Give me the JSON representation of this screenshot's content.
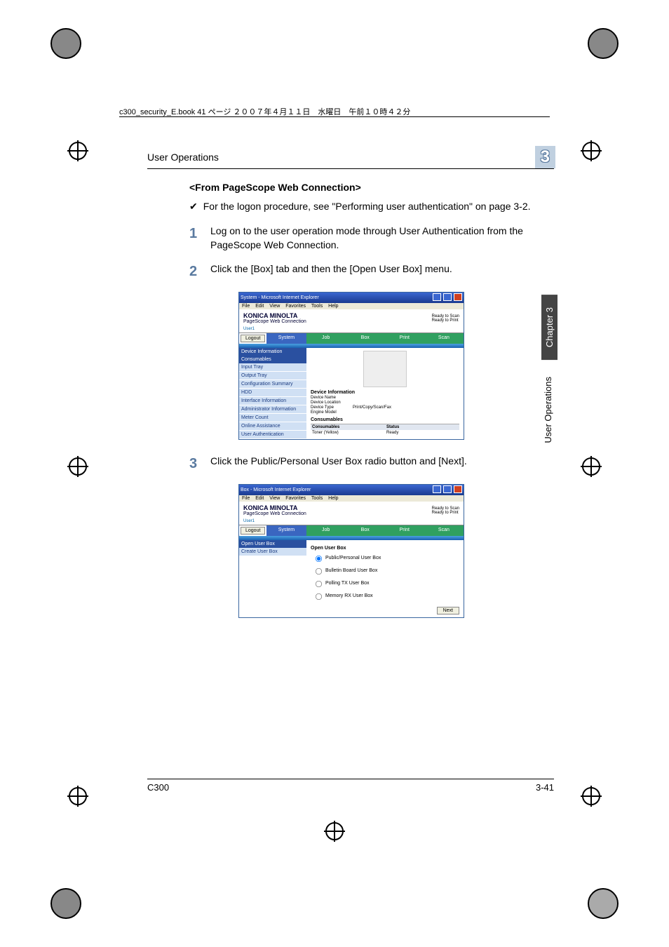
{
  "crop_header": "c300_security_E.book  41 ページ  ２００７年４月１１日　水曜日　午前１０時４２分",
  "running_head": {
    "title": "User Operations",
    "chapter_number": "3"
  },
  "section_title": "<From PageScope Web Connection>",
  "note": "For the logon procedure, see \"Performing user authentication\" on page 3-2.",
  "steps": {
    "s1": {
      "num": "1",
      "text": "Log on to the user operation mode through User Authentication from the PageScope Web Connection."
    },
    "s2": {
      "num": "2",
      "text": "Click the [Box] tab and then the [Open User Box] menu."
    },
    "s3": {
      "num": "3",
      "text": "Click the Public/Personal User Box radio button and [Next]."
    }
  },
  "shot1": {
    "title": "System - Microsoft Internet Explorer",
    "menus": [
      "File",
      "Edit",
      "View",
      "Favorites",
      "Tools",
      "Help"
    ],
    "brand": "KONICA MINOLTA",
    "brand2": "PageScope Web Connection",
    "status1": "Ready to Scan",
    "status2": "Ready to Print",
    "userline": "User1",
    "logout": "Logout",
    "tabs": [
      "System",
      "Job",
      "Box",
      "Print",
      "Scan"
    ],
    "side_items": [
      "Device Information",
      "Consumables",
      "Input Tray",
      "Output Tray",
      "Configuration Summary",
      "HDD",
      "Interface Information",
      "Administrator Information",
      "Meter Count",
      "Online Assistance",
      "User Authentication"
    ],
    "dev_info_label": "Device Information",
    "kv": [
      {
        "k": "Device Name",
        "v": ""
      },
      {
        "k": "Device Location",
        "v": ""
      },
      {
        "k": "Device Type",
        "v": "Print/Copy/Scan/Fax"
      },
      {
        "k": "Engine Model",
        "v": ""
      }
    ],
    "consumables_label": "Consumables",
    "table_header": {
      "c1": "Consumables",
      "c2": "Status"
    },
    "table_row": {
      "c1": "Toner (Yellow)",
      "c2": "Ready"
    }
  },
  "shot2": {
    "title": "Box - Microsoft Internet Explorer",
    "side_items": [
      "Open User Box",
      "Create User Box"
    ],
    "panel_title": "Open User Box",
    "radios": [
      "Public/Personal User Box",
      "Bulletin Board User Box",
      "Polling TX User Box",
      "Memory RX User Box"
    ],
    "next": "Next"
  },
  "sidetab": {
    "dark": "Chapter 3",
    "light": "User Operations"
  },
  "footer": {
    "left": "C300",
    "right": "3-41"
  }
}
